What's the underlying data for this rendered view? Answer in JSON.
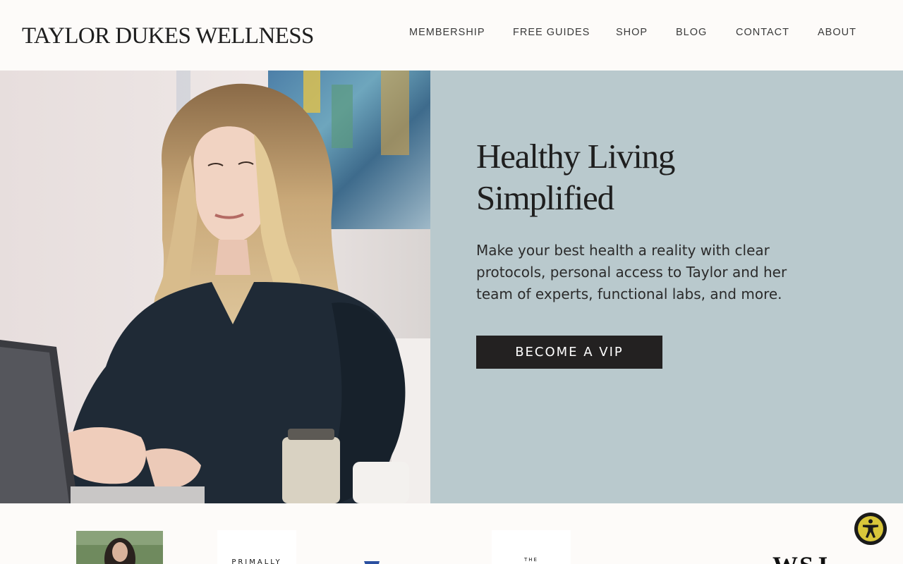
{
  "header": {
    "brand": "TAYLOR DUKES WELLNESS",
    "nav": [
      {
        "label": "MEMBERSHIP"
      },
      {
        "label": "FREE GUIDES"
      },
      {
        "label": "SHOP"
      },
      {
        "label": "BLOG"
      },
      {
        "label": "CONTACT"
      },
      {
        "label": "ABOUT"
      }
    ]
  },
  "hero": {
    "headline_line1": "Healthy Living",
    "headline_line2": "Simplified",
    "subtext": "Make your best health a reality with clear protocols, personal access to Taylor and her team of experts, functional labs, and more.",
    "cta_label": "BECOME A VIP",
    "panel_color": "#b9c9cd",
    "cta_color": "#232121"
  },
  "press": {
    "logos": [
      {
        "text": "PRIMALLY"
      },
      {
        "text": "THE"
      },
      {
        "text": "WSJ"
      }
    ]
  },
  "accessibility": {
    "icon": "accessibility-icon",
    "accent": "#d8c63a"
  }
}
